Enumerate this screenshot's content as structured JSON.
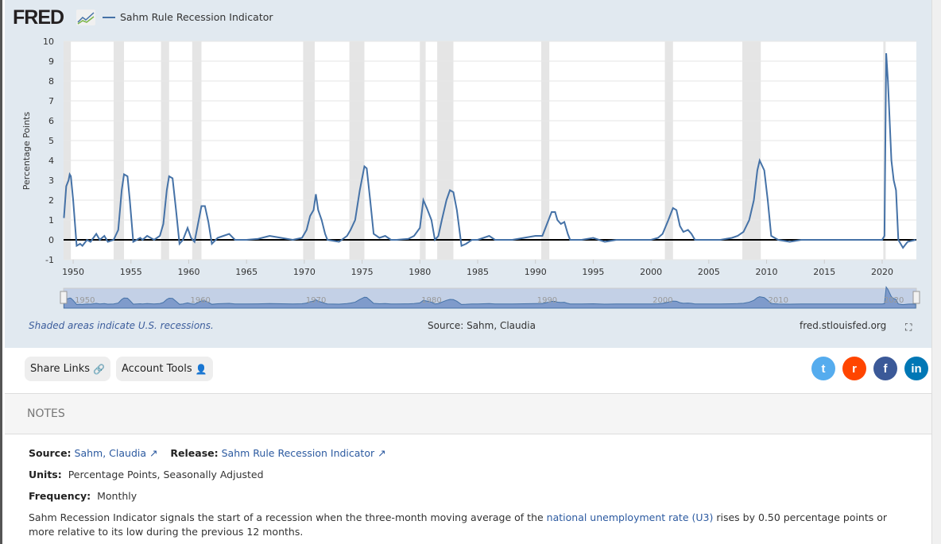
{
  "header": {
    "logo": "FRED",
    "series_title": "Sahm Rule Recession Indicator"
  },
  "colors": {
    "line": "#4572a7",
    "recession": "#e5e5e5",
    "background": "#e1e9f0"
  },
  "chart_data": {
    "type": "line",
    "title": "Sahm Rule Recession Indicator",
    "ylabel": "Percentage Points",
    "ylim": [
      -1,
      10
    ],
    "xlim": [
      1949.17,
      2022.96
    ],
    "yticks": [
      "-1",
      "0",
      "1",
      "2",
      "3",
      "4",
      "5",
      "6",
      "7",
      "8",
      "9",
      "10"
    ],
    "xticks": [
      "1950",
      "1955",
      "1960",
      "1965",
      "1970",
      "1975",
      "1980",
      "1985",
      "1990",
      "1995",
      "2000",
      "2005",
      "2010",
      "2015",
      "2020"
    ],
    "navigator_labels": [
      "1950",
      "1960",
      "1970",
      "1980",
      "1990",
      "2000",
      "2010",
      "2020"
    ],
    "recessions": [
      [
        1948.9,
        1949.8
      ],
      [
        1953.5,
        1954.4
      ],
      [
        1957.6,
        1958.3
      ],
      [
        1960.3,
        1961.1
      ],
      [
        1969.9,
        1970.9
      ],
      [
        1973.9,
        1975.2
      ],
      [
        1980.0,
        1980.5
      ],
      [
        1981.5,
        1982.9
      ],
      [
        1990.5,
        1991.2
      ],
      [
        2001.2,
        2001.9
      ],
      [
        2007.9,
        2009.5
      ],
      [
        2020.1,
        2020.3
      ]
    ],
    "series": [
      {
        "name": "Sahm Rule Recession Indicator",
        "points": [
          [
            1949.2,
            1.1
          ],
          [
            1949.4,
            2.7
          ],
          [
            1949.6,
            3.0
          ],
          [
            1949.7,
            3.3
          ],
          [
            1949.8,
            3.2
          ],
          [
            1950.0,
            2.0
          ],
          [
            1950.3,
            -0.3
          ],
          [
            1950.6,
            -0.2
          ],
          [
            1950.8,
            -0.3
          ],
          [
            1951.2,
            0
          ],
          [
            1951.5,
            -0.1
          ],
          [
            1952,
            0.3
          ],
          [
            1952.3,
            0
          ],
          [
            1952.7,
            0.2
          ],
          [
            1953,
            -0.1
          ],
          [
            1953.5,
            0
          ],
          [
            1953.9,
            0.5
          ],
          [
            1954.2,
            2.5
          ],
          [
            1954.4,
            3.3
          ],
          [
            1954.7,
            3.2
          ],
          [
            1954.9,
            2.0
          ],
          [
            1955.2,
            -0.1
          ],
          [
            1955.5,
            0
          ],
          [
            1955.8,
            0.1
          ],
          [
            1956,
            0
          ],
          [
            1956.4,
            0.2
          ],
          [
            1957,
            0
          ],
          [
            1957.5,
            0.2
          ],
          [
            1957.8,
            0.8
          ],
          [
            1958.1,
            2.5
          ],
          [
            1958.3,
            3.2
          ],
          [
            1958.6,
            3.1
          ],
          [
            1958.9,
            1.5
          ],
          [
            1959.2,
            -0.2
          ],
          [
            1959.5,
            0
          ],
          [
            1959.9,
            0.6
          ],
          [
            1960.2,
            0.1
          ],
          [
            1960.5,
            -0.1
          ],
          [
            1960.8,
            0.8
          ],
          [
            1961.1,
            1.7
          ],
          [
            1961.4,
            1.7
          ],
          [
            1961.7,
            0.9
          ],
          [
            1962,
            -0.2
          ],
          [
            1962.5,
            0.1
          ],
          [
            1963,
            0.2
          ],
          [
            1963.5,
            0.3
          ],
          [
            1964,
            0
          ],
          [
            1965,
            0
          ],
          [
            1966,
            0.05
          ],
          [
            1967,
            0.2
          ],
          [
            1968,
            0.1
          ],
          [
            1969,
            0
          ],
          [
            1969.8,
            0.1
          ],
          [
            1970.2,
            0.5
          ],
          [
            1970.5,
            1.2
          ],
          [
            1970.8,
            1.5
          ],
          [
            1971,
            2.3
          ],
          [
            1971.2,
            1.5
          ],
          [
            1971.5,
            1.0
          ],
          [
            1971.8,
            0.3
          ],
          [
            1972,
            0
          ],
          [
            1973,
            -0.1
          ],
          [
            1973.7,
            0.2
          ],
          [
            1974,
            0.5
          ],
          [
            1974.4,
            1.0
          ],
          [
            1974.8,
            2.5
          ],
          [
            1975.2,
            3.7
          ],
          [
            1975.4,
            3.6
          ],
          [
            1975.7,
            2.0
          ],
          [
            1976,
            0.3
          ],
          [
            1976.5,
            0.1
          ],
          [
            1977,
            0.2
          ],
          [
            1977.5,
            0
          ],
          [
            1978,
            0
          ],
          [
            1979,
            0.05
          ],
          [
            1979.5,
            0.2
          ],
          [
            1980,
            0.6
          ],
          [
            1980.3,
            2.0
          ],
          [
            1980.6,
            1.6
          ],
          [
            1981,
            1.0
          ],
          [
            1981.3,
            0
          ],
          [
            1981.6,
            0.2
          ],
          [
            1981.9,
            1.0
          ],
          [
            1982.3,
            2.0
          ],
          [
            1982.6,
            2.5
          ],
          [
            1982.9,
            2.4
          ],
          [
            1983.2,
            1.5
          ],
          [
            1983.6,
            -0.3
          ],
          [
            1984,
            -0.2
          ],
          [
            1984.5,
            0
          ],
          [
            1985,
            0
          ],
          [
            1986,
            0.2
          ],
          [
            1986.5,
            0
          ],
          [
            1987,
            0
          ],
          [
            1988,
            0
          ],
          [
            1989,
            0.1
          ],
          [
            1990,
            0.2
          ],
          [
            1990.6,
            0.2
          ],
          [
            1991,
            0.8
          ],
          [
            1991.4,
            1.4
          ],
          [
            1991.7,
            1.4
          ],
          [
            1991.9,
            1.0
          ],
          [
            1992.2,
            0.8
          ],
          [
            1992.5,
            0.9
          ],
          [
            1992.8,
            0.3
          ],
          [
            1993,
            0
          ],
          [
            1994,
            0
          ],
          [
            1995,
            0.1
          ],
          [
            1996,
            -0.1
          ],
          [
            1997,
            0
          ],
          [
            1998,
            0
          ],
          [
            1999,
            0
          ],
          [
            2000,
            0
          ],
          [
            2000.6,
            0.1
          ],
          [
            2001,
            0.3
          ],
          [
            2001.5,
            1.0
          ],
          [
            2001.9,
            1.6
          ],
          [
            2002.2,
            1.5
          ],
          [
            2002.5,
            0.7
          ],
          [
            2002.8,
            0.4
          ],
          [
            2003.2,
            0.5
          ],
          [
            2003.5,
            0.3
          ],
          [
            2003.8,
            0
          ],
          [
            2005,
            0
          ],
          [
            2006,
            0
          ],
          [
            2007,
            0.1
          ],
          [
            2007.5,
            0.2
          ],
          [
            2008,
            0.4
          ],
          [
            2008.5,
            1.0
          ],
          [
            2008.9,
            2.0
          ],
          [
            2009.2,
            3.5
          ],
          [
            2009.4,
            4.0
          ],
          [
            2009.8,
            3.5
          ],
          [
            2010.1,
            2.0
          ],
          [
            2010.4,
            0.2
          ],
          [
            2011,
            0
          ],
          [
            2012,
            -0.1
          ],
          [
            2013,
            0
          ],
          [
            2015,
            0
          ],
          [
            2017,
            0
          ],
          [
            2019,
            0
          ],
          [
            2020,
            0
          ],
          [
            2020.2,
            0.2
          ],
          [
            2020.35,
            9.4
          ],
          [
            2020.5,
            8.0
          ],
          [
            2020.8,
            4.0
          ],
          [
            2021,
            3.0
          ],
          [
            2021.2,
            2.5
          ],
          [
            2021.4,
            0
          ],
          [
            2021.8,
            -0.4
          ],
          [
            2022.2,
            -0.1
          ],
          [
            2022.9,
            0
          ]
        ]
      }
    ]
  },
  "footer": {
    "shaded_note": "Shaded areas indicate U.S. recessions.",
    "source": "Source: Sahm, Claudia",
    "site": "fred.stlouisfed.org"
  },
  "buttons": {
    "share": "Share Links",
    "account": "Account Tools"
  },
  "notes": {
    "heading": "NOTES",
    "source_label": "Source:",
    "source_value": "Sahm, Claudia",
    "release_label": "Release:",
    "release_value": "Sahm Rule Recession Indicator",
    "units_label": "Units:",
    "units_value": "Percentage Points, Seasonally Adjusted",
    "frequency_label": "Frequency:",
    "frequency_value": "Monthly",
    "desc_before": "Sahm Recession Indicator signals the start of a recession when the three-month moving average of the ",
    "desc_link": "national unemployment rate (U3)",
    "desc_after": " rises by 0.50 percentage points or more relative to its low during the previous 12 months."
  }
}
